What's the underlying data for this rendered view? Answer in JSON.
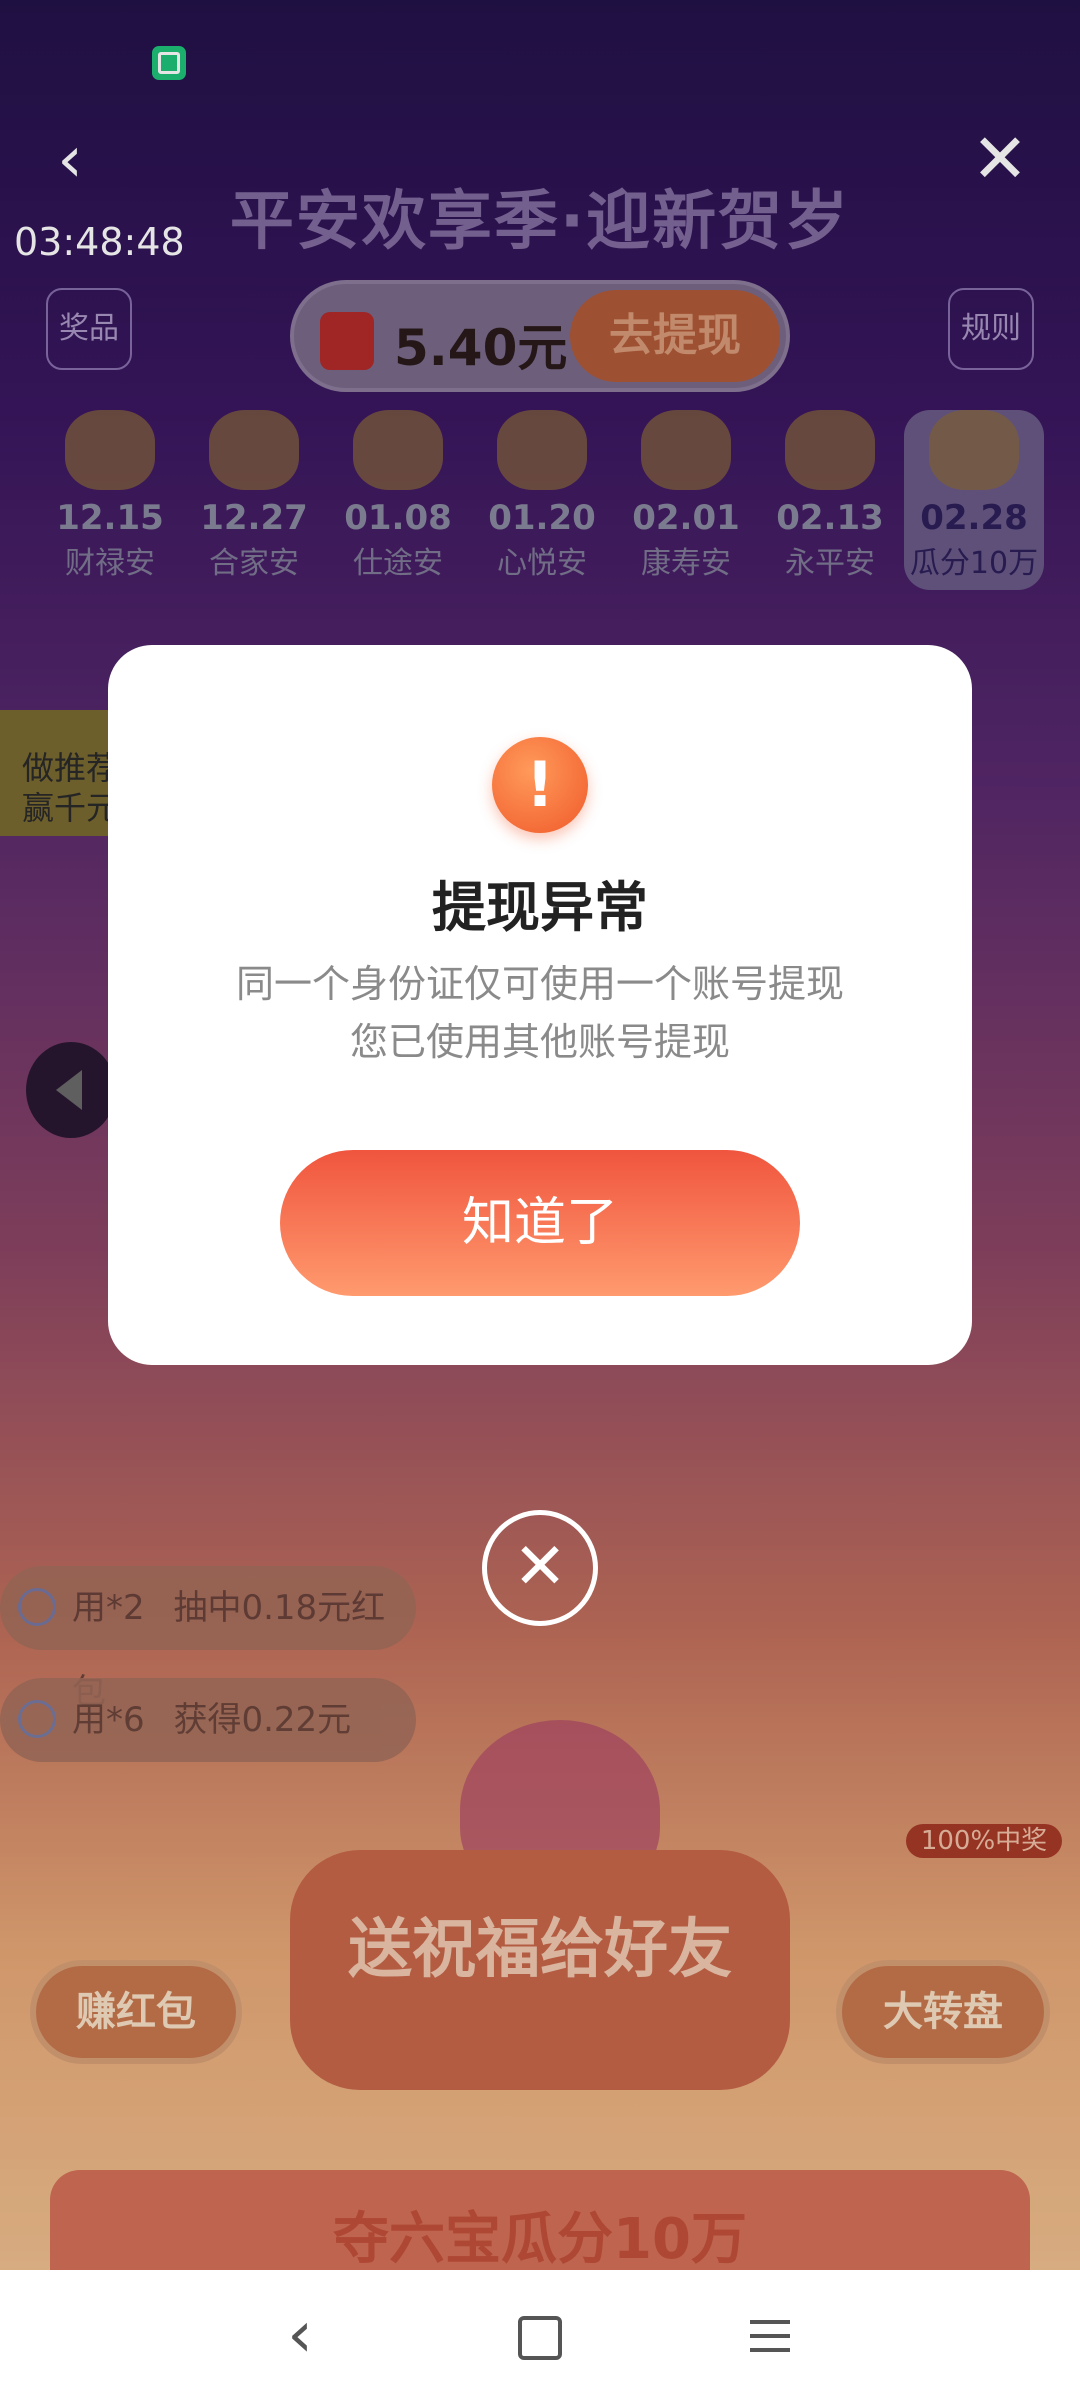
{
  "status_bar": {
    "app_icon": "wallet-app-icon"
  },
  "header": {
    "back_icon": "‹",
    "close_icon": "✕",
    "clock": "03:48:48",
    "title": "平安欢享季·迎新贺岁"
  },
  "top_controls": {
    "prize_label": "奖品",
    "rules_label": "规则",
    "balance_amount": "5.40元",
    "withdraw_label": "去提现"
  },
  "days": [
    {
      "date": "12.15",
      "name": "财禄安"
    },
    {
      "date": "12.27",
      "name": "合家安"
    },
    {
      "date": "01.08",
      "name": "仕途安"
    },
    {
      "date": "01.20",
      "name": "心悦安"
    },
    {
      "date": "02.01",
      "name": "康寿安"
    },
    {
      "date": "02.13",
      "name": "永平安"
    },
    {
      "date": "02.28",
      "name": "瓜分10万"
    }
  ],
  "recommend": {
    "label": "做推荐\n赢千元"
  },
  "tickers": [
    {
      "user": "用*2",
      "text": "抽中0.18元红包"
    },
    {
      "user": "用*6",
      "text": "获得0.22元"
    }
  ],
  "bottom": {
    "earn_label": "赚红包",
    "send_label": "送祝福给好友",
    "wheel_label": "大转盘",
    "wheel_badge": "100%中奖",
    "banner": "夺六宝瓜分10万"
  },
  "modal": {
    "icon": "!",
    "title": "提现异常",
    "line1": "同一个身份证仅可使用一个账号提现",
    "line2": "您已使用其他账号提现",
    "ok_label": "知道了",
    "close_icon": "✕"
  },
  "navbar": {
    "back_icon": "‹"
  }
}
